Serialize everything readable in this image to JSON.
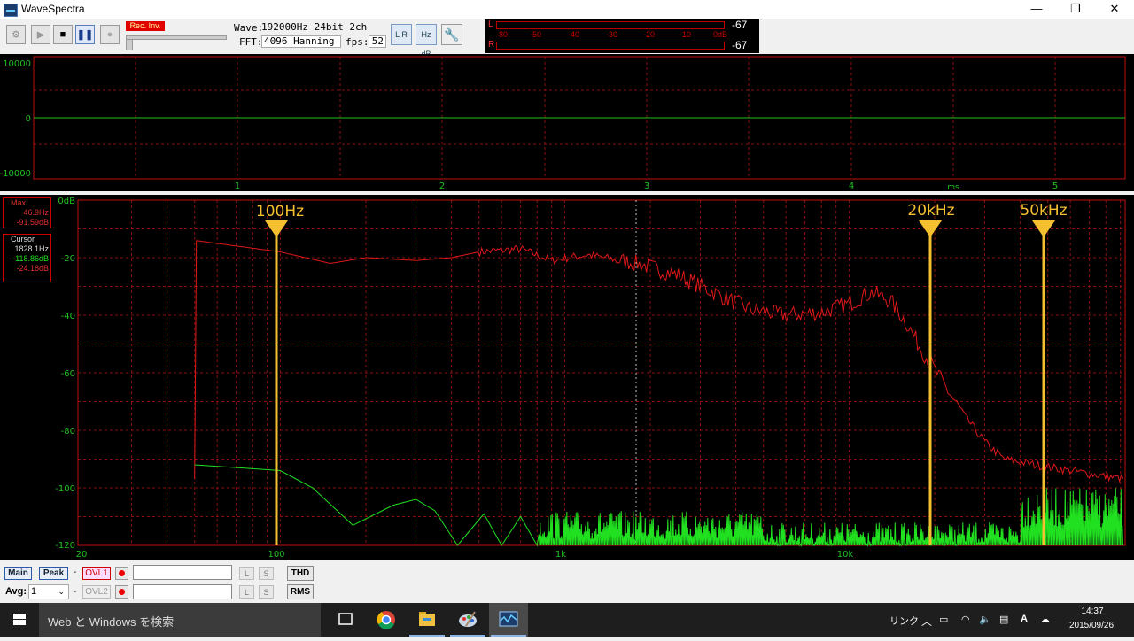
{
  "window": {
    "title": "WaveSpectra",
    "minimize": "—",
    "maximize": "❐",
    "close": "✕"
  },
  "toolbar": {
    "rec_label": "Rec. Inv.",
    "wave_label": "Wave:",
    "wave_value": "192000Hz 24bit 2ch",
    "fft_label": "FFT:",
    "fft_value": "4096 Hanning",
    "fps_label": "fps:",
    "fps_value": "52",
    "lr_icon": "L R",
    "hzdb_icon": "Hz dB"
  },
  "meter": {
    "left_label": "L",
    "right_label": "R",
    "left_value": "-67",
    "right_value": "-67",
    "scale": [
      "-80",
      "-50",
      "-40",
      "-30",
      "-20",
      "-10",
      "0dB"
    ]
  },
  "wave_panel": {
    "y_labels": [
      "10000",
      "0",
      "-10000"
    ],
    "x_labels": [
      "1",
      "2",
      "3",
      "4",
      "5"
    ],
    "x_unit": "ms"
  },
  "spectrum": {
    "max_box": {
      "title": "Max",
      "freq": "46.9Hz",
      "level": "-91.59dB"
    },
    "cursor_box": {
      "title": "Cursor",
      "freq": "1828.1Hz",
      "level1": "-118.86dB",
      "level2": "-24.18dB"
    },
    "y_labels": [
      "0dB",
      "-20",
      "-40",
      "-60",
      "-80",
      "-100",
      "-120"
    ],
    "x_labels": [
      "20",
      "100",
      "1k",
      "10k"
    ],
    "markers": [
      "100Hz",
      "20kHz",
      "50kHz"
    ]
  },
  "controls": {
    "main": "Main",
    "peak": "Peak",
    "dash1": "-",
    "ovl1": "OVL1",
    "avg_label": "Avg:",
    "avg_value": "1",
    "dash2": "-",
    "ovl2": "OVL2",
    "l": "L",
    "s": "S",
    "thd": "THD",
    "rms": "RMS"
  },
  "taskbar": {
    "search_placeholder": "Web と Windows を検索",
    "link_label": "リンク",
    "ime": "A",
    "time": "14:37",
    "date": "2015/09/26"
  },
  "colors": {
    "bg_black": "#000000",
    "grid_red": "#8a1010",
    "trace_red": "#e01818",
    "trace_green": "#20e020",
    "marker_yellow": "#f5c030",
    "label_red": "#e03030"
  }
}
